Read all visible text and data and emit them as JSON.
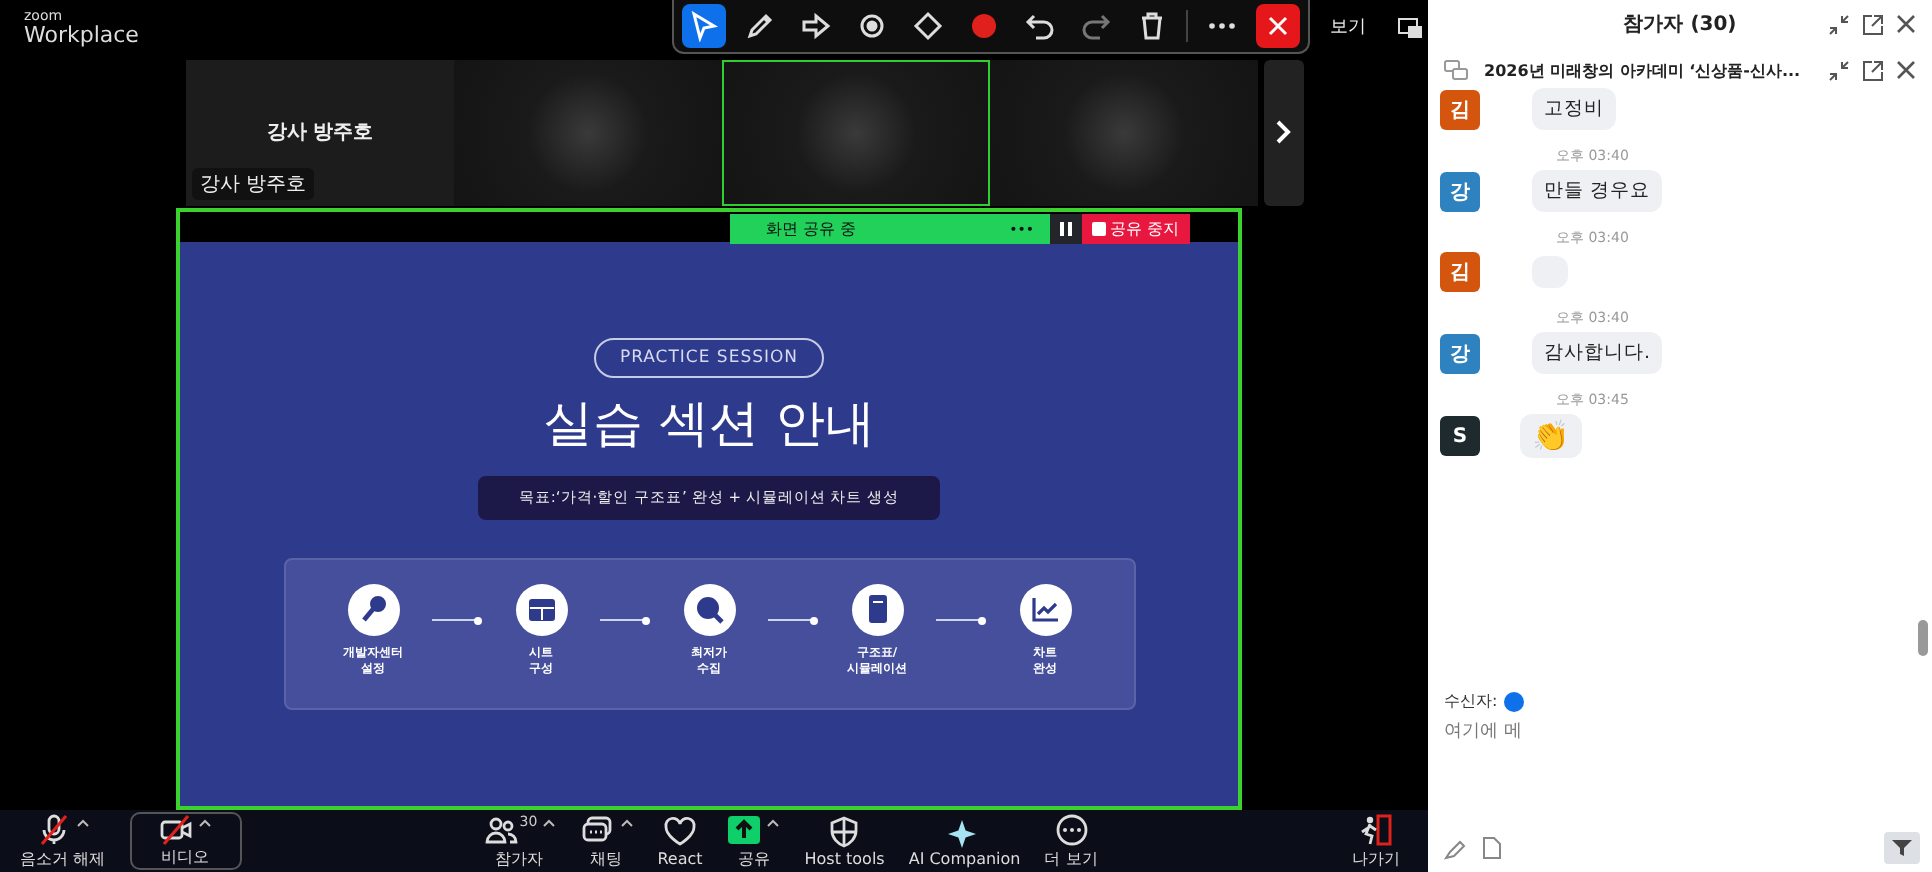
{
  "app": {
    "brand_small": "zoom",
    "brand": "Workplace"
  },
  "annotation_tools": [
    {
      "kind": "select",
      "selected": true
    },
    {
      "kind": "pen",
      "selected": false
    },
    {
      "kind": "arrow",
      "selected": false
    },
    {
      "kind": "spotlight",
      "selected": false
    },
    {
      "kind": "eraser",
      "selected": false
    },
    {
      "kind": "color",
      "selected": false
    },
    {
      "kind": "undo",
      "selected": false
    },
    {
      "kind": "redo",
      "selected": false
    },
    {
      "kind": "trash",
      "selected": false
    },
    {
      "kind": "more",
      "selected": false
    },
    {
      "kind": "close",
      "selected": false
    }
  ],
  "view_button": "보기",
  "thumbnails": [
    {
      "kind": "named",
      "name": "강사 방주호",
      "label": "강사 방주호",
      "speaking": false
    },
    {
      "kind": "blurred",
      "speaking": false
    },
    {
      "kind": "blurred",
      "speaking": true
    },
    {
      "kind": "blurred",
      "speaking": false
    }
  ],
  "share_bar": {
    "status": "화면 공유 중",
    "more": "•••",
    "stop": "공유 중지"
  },
  "slide": {
    "badge": "PRACTICE SESSION",
    "title": "실습 섹션 안내",
    "goal": "목표:‘가격·할인 구조표’ 완성 + 시뮬레이션 차트 생성",
    "steps": [
      {
        "kind": "key",
        "lines": [
          "개발자센터",
          "설정"
        ]
      },
      {
        "kind": "table",
        "lines": [
          "시트",
          "구성"
        ]
      },
      {
        "kind": "price",
        "lines": [
          "최저가",
          "수집"
        ]
      },
      {
        "kind": "calculator",
        "lines": [
          "구조표/",
          "시뮬레이션"
        ]
      },
      {
        "kind": "chart",
        "lines": [
          "차트",
          "완성"
        ]
      }
    ]
  },
  "toolbar": [
    {
      "kind": "mic",
      "label": "음소거 해제",
      "off": true,
      "caret": true
    },
    {
      "kind": "video",
      "label": "비디오",
      "off": true,
      "caret": true
    },
    {
      "kind": "participants",
      "label": "참가자",
      "count": "30",
      "off": false,
      "caret": true
    },
    {
      "kind": "chat",
      "label": "채팅",
      "off": false,
      "caret": true
    },
    {
      "kind": "react",
      "label": "React",
      "off": false,
      "caret": false
    },
    {
      "kind": "share",
      "label": "공유",
      "off": false,
      "caret": true
    },
    {
      "kind": "host",
      "label": "Host tools",
      "off": false,
      "caret": false
    },
    {
      "kind": "ai",
      "label": "AI Companion",
      "off": false,
      "caret": false
    },
    {
      "kind": "more",
      "label": "더 보기",
      "off": false,
      "caret": false
    }
  ],
  "leave": "나가기",
  "chat_panel": {
    "title": "참가자 (30)",
    "chat_title": "2026년 미래창의 아카데미 ‘신상품-신사...",
    "messages": [
      {
        "kind": "text",
        "avatar": "김",
        "color": "#d4560e",
        "text": "고정비"
      },
      {
        "kind": "text",
        "time": "오후 03:40",
        "avatar": "강",
        "color": "#2f82c0",
        "text": "만들 경우요"
      },
      {
        "kind": "blurred",
        "time": "오후 03:40",
        "avatar": "김",
        "color": "#d4560e"
      },
      {
        "kind": "text",
        "time": "오후 03:40",
        "avatar": "강",
        "color": "#2f82c0",
        "text": "감사합니다."
      },
      {
        "kind": "emoji",
        "time": "오후 03:45",
        "avatar": "S",
        "color": "#1f2a2f",
        "text": "👏"
      }
    ],
    "recipient_label": "수신자:",
    "placeholder": "여기에 메"
  }
}
